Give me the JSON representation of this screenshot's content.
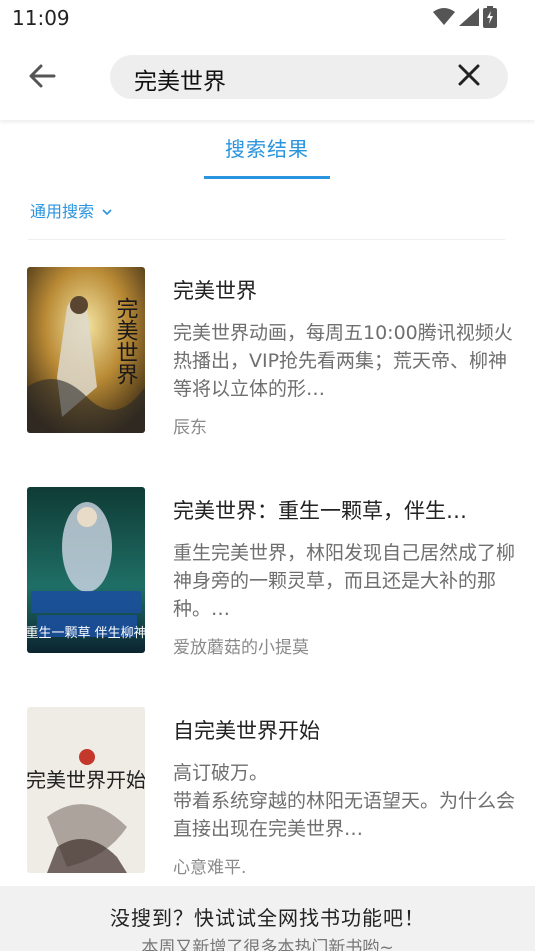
{
  "status": {
    "time": "11:09",
    "icons": [
      "wifi-icon",
      "signal-icon",
      "battery-icon"
    ]
  },
  "header": {
    "back_icon": "arrow-left-icon",
    "search_value": "完美世界",
    "clear_icon": "close-icon"
  },
  "tabs": {
    "active_label": "搜索结果"
  },
  "filter": {
    "label": "通用搜索",
    "icon": "chevron-down-icon"
  },
  "results": [
    {
      "title": "完美世界",
      "description": "完美世界动画，每周五10:00腾讯视频火热播出，VIP抢先看两集；荒天帝、柳神等将以立体的形…",
      "author": "辰东",
      "cover_text": "完美世界"
    },
    {
      "title": "完美世界：重生一颗草，伴生…",
      "description": "重生完美世界，林阳发现自己居然成了柳神身旁的一颗灵草，而且还是大补的那种。…",
      "author": "爱放蘑菇的小提莫",
      "cover_text": "重生一颗草 伴生柳神"
    },
    {
      "title": "自完美世界开始",
      "description": "高订破万。\n带着系统穿越的林阳无语望天。为什么会直接出现在完美世界…",
      "author": "心意难平.",
      "cover_text": "完美世界开始"
    }
  ],
  "banner": {
    "title": "没搜到？快试试全网找书功能吧！",
    "subtitle": "本周又新增了很多本热门新书哟~"
  },
  "colors": {
    "accent": "#2a94de",
    "banner_bg": "#f1f1f1",
    "search_bg": "#eeeeee"
  }
}
